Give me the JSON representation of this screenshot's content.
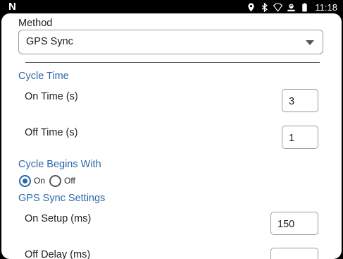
{
  "status_bar": {
    "logo": "N",
    "time": "11:18",
    "icons": [
      "location-icon",
      "bluetooth-icon",
      "wifi-icon",
      "sync-icon",
      "battery-icon"
    ]
  },
  "form": {
    "method_label": "Method",
    "method_value": "GPS Sync",
    "cycle_time_header": "Cycle Time",
    "on_time_label": "On Time (s)",
    "on_time_value": "3",
    "off_time_label": "Off Time (s)",
    "off_time_value": "1",
    "cycle_begins_header": "Cycle Begins With",
    "radio_on_label": "On",
    "radio_off_label": "Off",
    "radio_selected": "On",
    "gps_sync_header": "GPS Sync Settings",
    "on_setup_label": "On Setup (ms)",
    "on_setup_value": "150",
    "off_delay_label": "Off Delay (ms)",
    "off_delay_value": ""
  },
  "colors": {
    "accent": "#2a67a8",
    "text": "#202020",
    "border": "#9a9a9a"
  }
}
